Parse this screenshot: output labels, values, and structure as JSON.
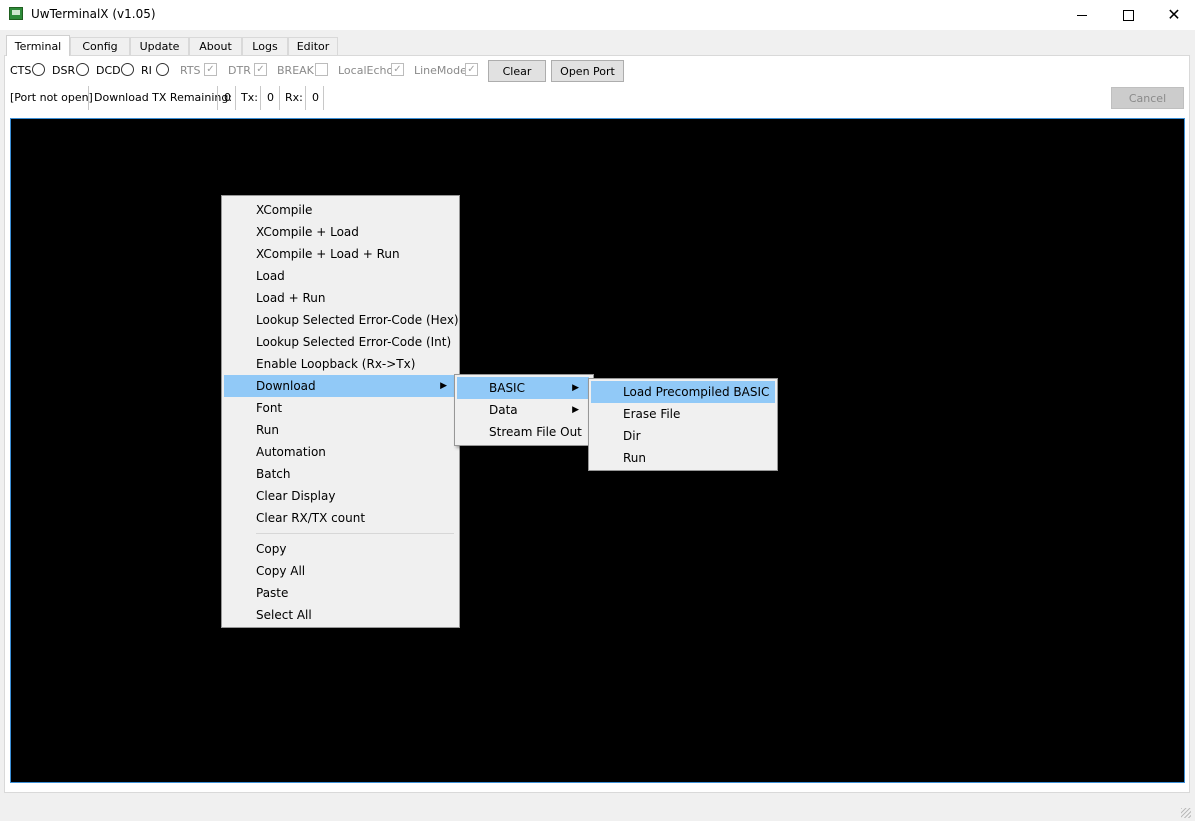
{
  "window": {
    "title": "UwTerminalX (v1.05)",
    "minimize_icon": "minimize-icon",
    "maximize_icon": "maximize-icon",
    "close_icon": "close-icon"
  },
  "tabs": [
    {
      "label": "Terminal",
      "active": true
    },
    {
      "label": "Config"
    },
    {
      "label": "Update"
    },
    {
      "label": "About"
    },
    {
      "label": "Logs"
    },
    {
      "label": "Editor"
    }
  ],
  "signals": {
    "cts": "CTS",
    "dsr": "DSR",
    "dcd": "DCD",
    "ri": "RI",
    "rts": "RTS",
    "dtr": "DTR",
    "break": "BREAK",
    "local_echo": "LocalEcho",
    "line_mode": "LineMode",
    "rts_checked": true,
    "dtr_checked": true,
    "break_checked": false,
    "local_echo_checked": true,
    "line_mode_checked": true
  },
  "buttons": {
    "clear": "Clear",
    "open_port": "Open Port",
    "cancel": "Cancel"
  },
  "status": {
    "port_state": "[Port not open]",
    "download_label": "Download TX Remaining:",
    "download_value": "0",
    "tx_label": "Tx:",
    "tx_value": "0",
    "rx_label": "Rx:",
    "rx_value": "0"
  },
  "context_menu": {
    "items": [
      "XCompile",
      "XCompile + Load",
      "XCompile + Load + Run",
      "Load",
      "Load + Run",
      "Lookup Selected Error-Code (Hex)",
      "Lookup Selected Error-Code (Int)",
      "Enable Loopback (Rx->Tx)",
      "Download",
      "Font",
      "Run",
      "Automation",
      "Batch",
      "Clear Display",
      "Clear RX/TX count"
    ],
    "items2": [
      "Copy",
      "Copy All",
      "Paste",
      "Select All"
    ],
    "highlighted": "Download"
  },
  "download_submenu": {
    "items": [
      "BASIC",
      "Data",
      "Stream File Out"
    ],
    "highlighted": "BASIC"
  },
  "basic_submenu": {
    "items": [
      "Load Precompiled BASIC",
      "Erase File",
      "Dir",
      "Run"
    ],
    "highlighted": "Load Precompiled BASIC"
  },
  "colors": {
    "menu_highlight": "#91c9f7",
    "terminal_bg": "#000000",
    "terminal_border": "#3c8fd6"
  }
}
